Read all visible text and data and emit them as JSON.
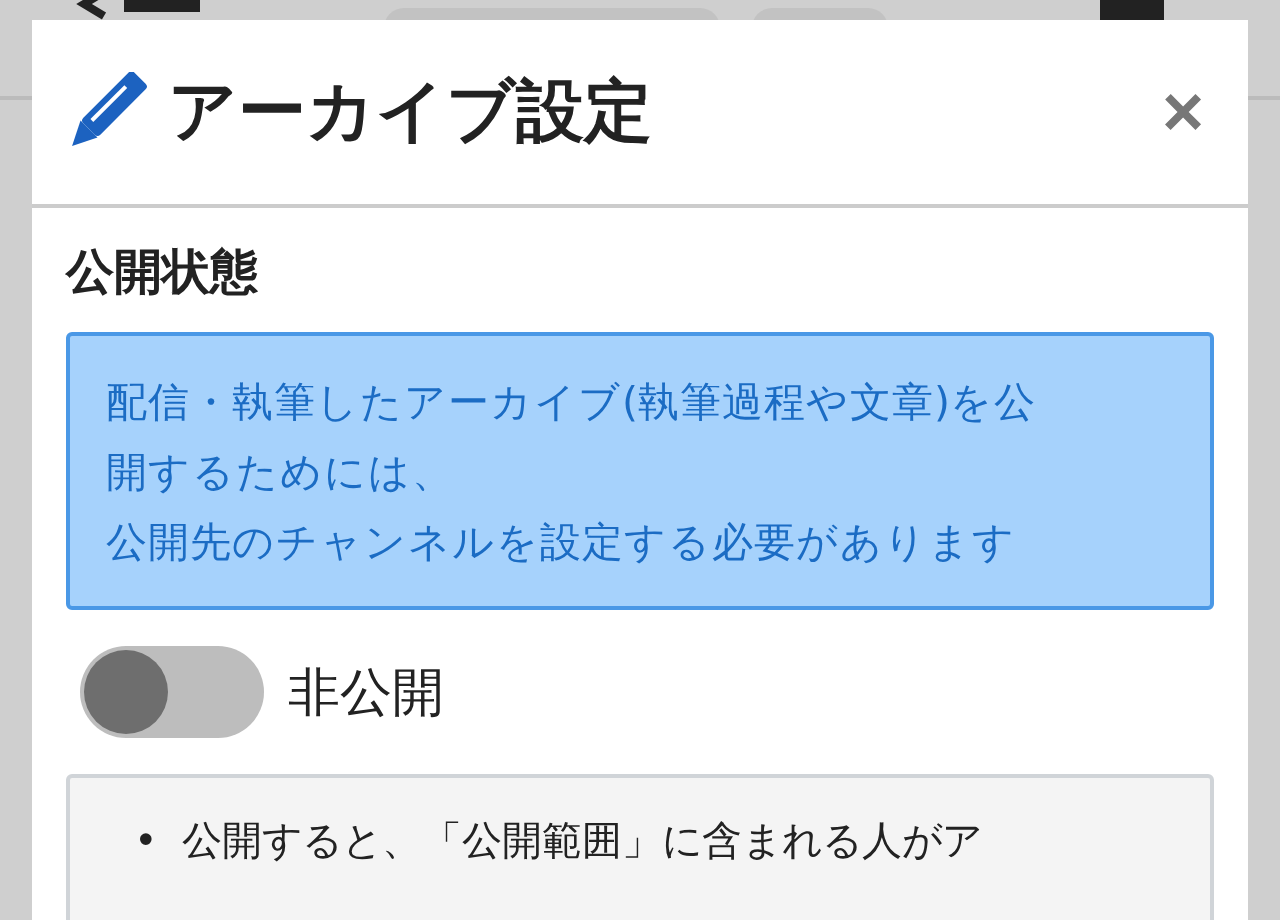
{
  "dialog": {
    "title": "アーカイブ設定",
    "close": "×"
  },
  "section": {
    "heading": "公開状態"
  },
  "info": [
    "配信・執筆したアーカイブ(執筆過程や文章)を公開するためには、",
    "公開先のチャンネルを設定する必要があります"
  ],
  "visibility": {
    "on": false,
    "label": "非公開"
  },
  "notes": [
    {
      "bullet": "•",
      "text": "公開すると、「公開範囲」に含まれる人がア"
    }
  ]
}
